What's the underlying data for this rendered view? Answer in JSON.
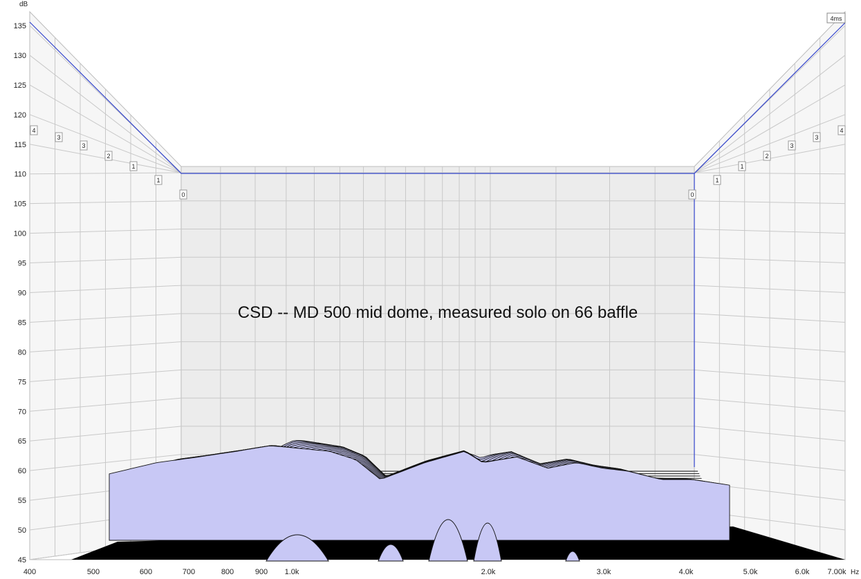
{
  "chart_data": {
    "type": "waterfall",
    "title": "CSD  --  MD 500 mid dome,  measured solo on 66 baffle",
    "y_unit": "dB",
    "x_unit": "Hz",
    "time_marker": "4ms",
    "y_ticks": [
      "135",
      "130",
      "125",
      "120",
      "115",
      "110",
      "105",
      "100",
      "95",
      "90",
      "85",
      "80",
      "75",
      "70",
      "65",
      "60",
      "55",
      "50",
      "45"
    ],
    "ylim": [
      43,
      137
    ],
    "x_ticks": [
      {
        "label": "400",
        "hz": 400
      },
      {
        "label": "500",
        "hz": 500
      },
      {
        "label": "600",
        "hz": 600
      },
      {
        "label": "700",
        "hz": 700
      },
      {
        "label": "800",
        "hz": 800
      },
      {
        "label": "900",
        "hz": 900
      },
      {
        "label": "1.0k",
        "hz": 1000
      },
      {
        "label": "2.0k",
        "hz": 2000
      },
      {
        "label": "3.0k",
        "hz": 3000
      },
      {
        "label": "4.0k",
        "hz": 4000
      },
      {
        "label": "5.0k",
        "hz": 5000
      },
      {
        "label": "6.0k",
        "hz": 6000
      },
      {
        "label": "7.00k",
        "hz": 7000
      }
    ],
    "xlim": [
      400,
      7000
    ],
    "x_scale": "log",
    "time_ticks_left": [
      "4",
      "3",
      "3",
      "2",
      "1",
      "1",
      "0"
    ],
    "time_ticks_right": [
      "0",
      "1",
      "1",
      "2",
      "3",
      "3",
      "4"
    ],
    "n_slices": 30,
    "front_slice_top_db": {
      "freq_hz": [
        700,
        800,
        900,
        1000,
        1100,
        1200,
        1300,
        1400,
        1500,
        1700,
        1900,
        2000,
        2200,
        2400,
        2600,
        2800,
        3000,
        3300,
        3600,
        4000
      ],
      "level_db": [
        59,
        61,
        62,
        63,
        64,
        63.5,
        63,
        61.5,
        58,
        61,
        63,
        61,
        62,
        60,
        61,
        60,
        59.5,
        58,
        58,
        57
      ]
    },
    "colors": {
      "surface": "#c8c8f5",
      "outline": "#111111",
      "grid": "#c8c8c8",
      "marker": "#3344cc"
    }
  }
}
